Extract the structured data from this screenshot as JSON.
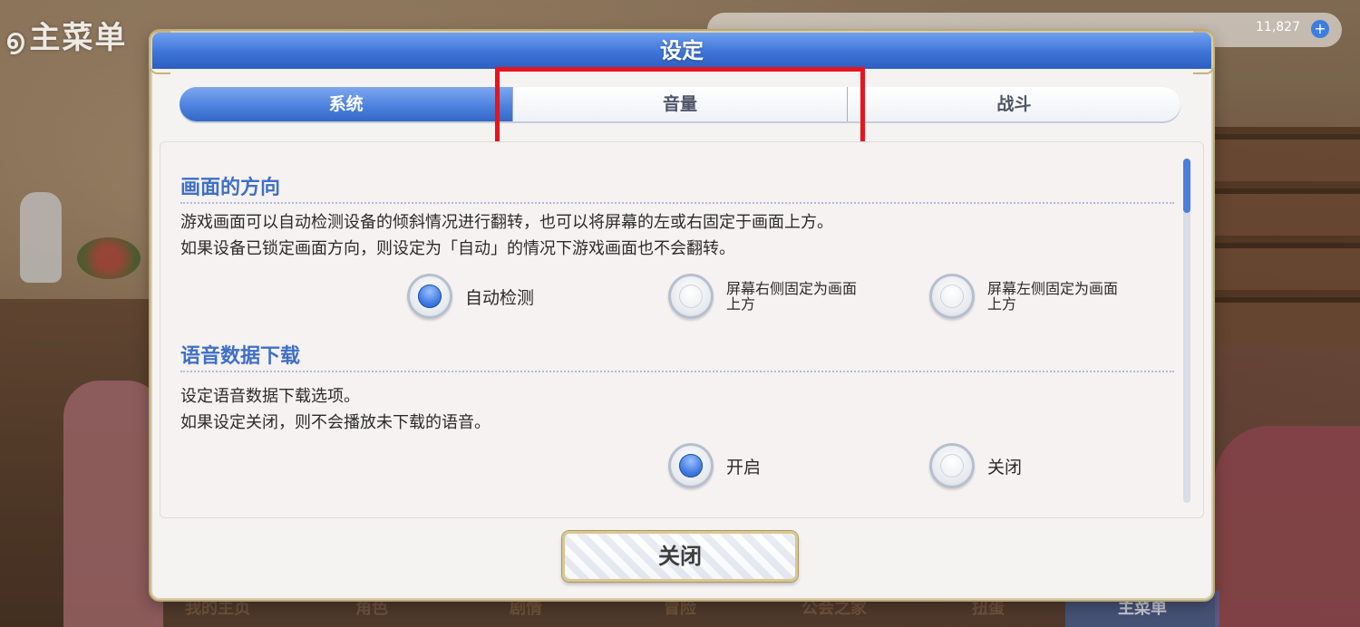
{
  "background": {
    "main_menu_title": "主菜单",
    "gold": "11,827",
    "bottom_nav": [
      "我的主页",
      "角色",
      "剧情",
      "冒险",
      "公会之家",
      "扭蛋",
      "主菜单"
    ]
  },
  "dialog": {
    "title": "设定",
    "tabs": [
      {
        "label": "系统",
        "active": true
      },
      {
        "label": "音量",
        "active": false
      },
      {
        "label": "战斗",
        "active": false
      }
    ],
    "sections": [
      {
        "title": "画面的方向",
        "desc": [
          "游戏画面可以自动检测设备的倾斜情况进行翻转，也可以将屏幕的左或右固定于画面上方。",
          "如果设备已锁定画面方向，则设定为「自动」的情况下游戏画面也不会翻转。"
        ],
        "options": [
          {
            "label": "自动检测",
            "checked": true
          },
          {
            "label": "屏幕右侧固定为画面上方",
            "checked": false
          },
          {
            "label": "屏幕左侧固定为画面上方",
            "checked": false
          }
        ]
      },
      {
        "title": "语音数据下载",
        "desc": [
          "设定语音数据下载选项。",
          "如果设定关闭，则不会播放未下载的语音。"
        ],
        "options": [
          {
            "label": "开启",
            "checked": true
          },
          {
            "label": "关闭",
            "checked": false
          }
        ]
      }
    ],
    "close_label": "关闭"
  },
  "colors": {
    "accent_blue": "#3d74d6",
    "section_title": "#3f6fc7",
    "highlight_red": "#e8141c"
  }
}
